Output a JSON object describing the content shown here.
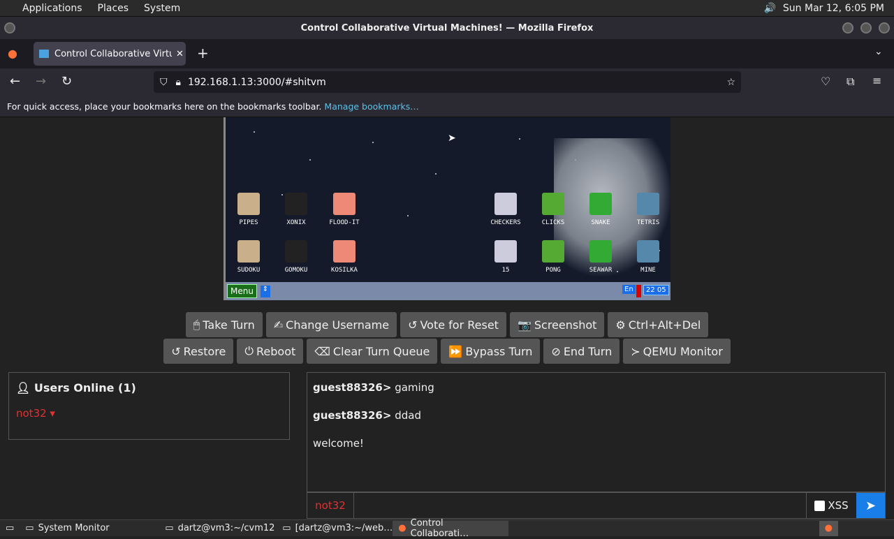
{
  "panel": {
    "applications": "Applications",
    "places": "Places",
    "system": "System",
    "clock": "Sun Mar 12,  6:05 PM"
  },
  "window": {
    "title": "Control Collaborative Virtual Machines! — Mozilla Firefox"
  },
  "tab": {
    "label": "Control Collaborative Virtua",
    "close": "✕",
    "new": "+"
  },
  "url": {
    "value": "192.168.1.13:3000/#shitvm"
  },
  "bookmarks": {
    "text": "For quick access, place your bookmarks here on the bookmarks toolbar.",
    "link": "Manage bookmarks…"
  },
  "vm": {
    "icons_row1": [
      "PIPES",
      "XONIX",
      "FLOOD-IT",
      "CHECKERS",
      "CLICKS",
      "SNAKE",
      "TETRIS"
    ],
    "icons_row2": [
      "SUDOKU",
      "GOMOKU",
      "KOSILKA",
      "15",
      "PONG",
      "SEAWAR",
      "MINE"
    ],
    "menu": "Menu",
    "lang": "En",
    "time": "22 05"
  },
  "buttons_row1": [
    "Take Turn",
    "Change Username",
    "Vote for Reset",
    "Screenshot",
    "Ctrl+Alt+Del"
  ],
  "buttons_row2": [
    "Restore",
    "Reboot",
    "Clear Turn Queue",
    "Bypass Turn",
    "End Turn",
    "QEMU Monitor"
  ],
  "users": {
    "header": "Users Online (1)",
    "user": "not32"
  },
  "chat": {
    "messages": [
      {
        "user": "guest88326>",
        "text": " gaming"
      },
      {
        "user": "guest88326>",
        "text": " ddad"
      },
      {
        "user": "",
        "text": "welcome!"
      }
    ],
    "username": "not32",
    "xss": "XSS"
  },
  "taskbar": [
    "System Monitor",
    "dartz@vm3:~/cvm12",
    "[dartz@vm3:~/web…",
    "Control Collaborati…"
  ]
}
